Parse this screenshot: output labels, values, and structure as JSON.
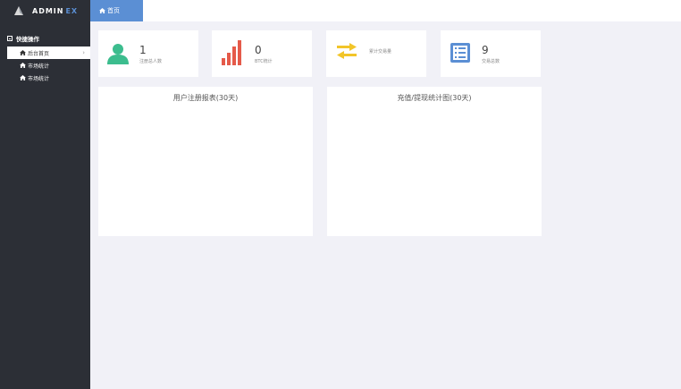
{
  "app": {
    "logo_main": "ADMIN",
    "logo_ex": "EX"
  },
  "sidebar": {
    "section_label": "快捷操作",
    "items": [
      {
        "label": "后台首页",
        "active": true
      },
      {
        "label": "市场统计"
      },
      {
        "label": "市场统计"
      }
    ]
  },
  "header": {
    "tab_label": "首页"
  },
  "stats": [
    {
      "value": "1",
      "label": "注册总人数",
      "icon": "user-icon",
      "color": "#3cbd8e"
    },
    {
      "value": "0",
      "label": "BTC统计",
      "icon": "bar-chart-icon",
      "color": "#e55a4a"
    },
    {
      "value": "",
      "label": "累计交易量",
      "icon": "exchange-arrows-icon",
      "color": "#f2c529"
    },
    {
      "value": "9",
      "label": "交易总数",
      "icon": "list-icon",
      "color": "#5b8fd4"
    }
  ],
  "panels": [
    {
      "title": "用户注册报表(30天)"
    },
    {
      "title": "充值/提现统计图(30天)"
    }
  ]
}
